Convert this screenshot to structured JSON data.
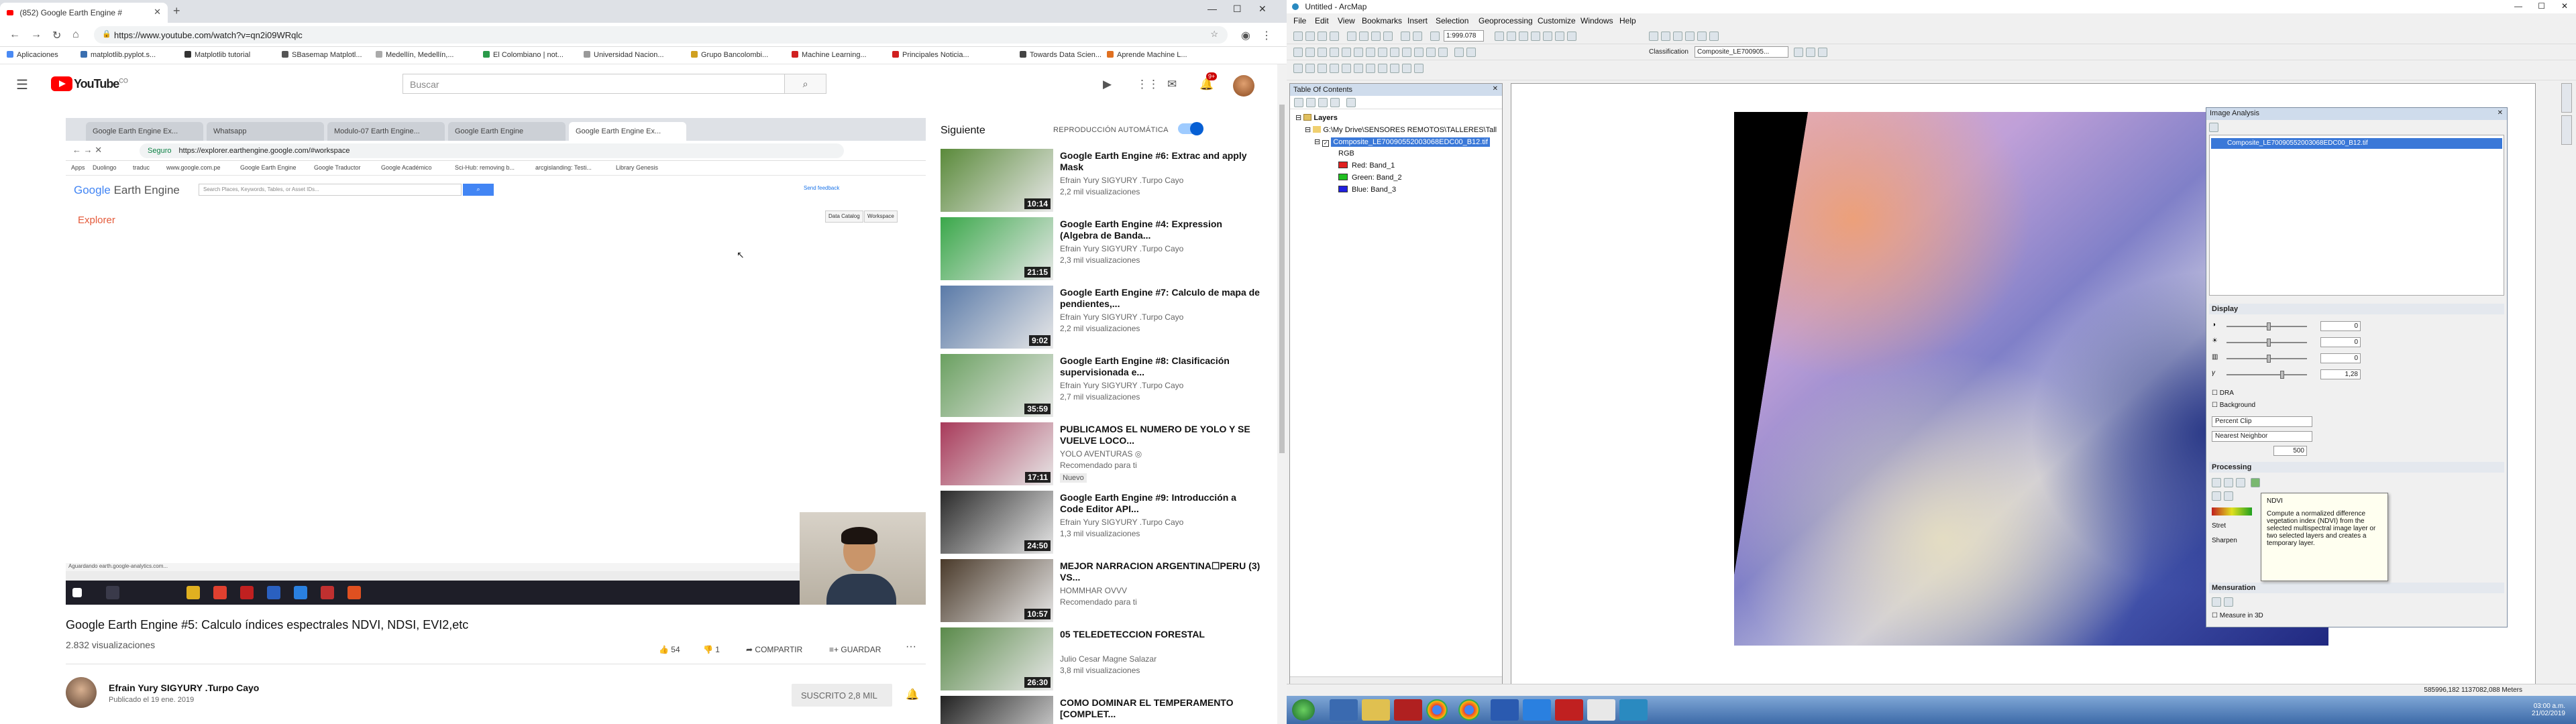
{
  "chrome": {
    "tab_title": "(852) Google Earth Engine #",
    "url": "https://www.youtube.com/watch?v=qn2i09WRqlc",
    "bookmarks": [
      "Aplicaciones",
      "matplotlib.pyplot.s...",
      "Matplotlib tutorial",
      "SBasemap Matplotl...",
      "Medellín, Medellín,...",
      "El Colombiano | not...",
      "Universidad Nacion...",
      "Grupo Bancolombi...",
      "Machine Learning...",
      "Principales Noticia...",
      "Machine Learning...",
      "Towards Data Scien...",
      "Aprende Machine L..."
    ]
  },
  "youtube": {
    "logo_text": "YouTube",
    "logo_country": "CO",
    "search_placeholder": "Buscar",
    "notification_count": "9+",
    "video": {
      "inner_tabs": [
        "Google Earth Engine Ex...",
        "Whatsapp",
        "Modulo-07 Earth Engine...",
        "Google Earth Engine",
        "Google Earth Engine Ex..."
      ],
      "inner_url": "https://explorer.earthengine.google.com/#workspace",
      "inner_secure": "Seguro",
      "inner_bookmarks": [
        "Apps",
        "Duolingo",
        "traduc",
        "www.google.com.pe",
        "Google Earth Engine",
        "Google Traductor",
        "Google Académico",
        "Sci-Hub: removing b...",
        "arcgislanding: Testi...",
        "Library Genesis"
      ],
      "gee_logo_prefix": "Google",
      "gee_logo_suffix": "Earth Engine",
      "gee_search_placeholder": "Search Places, Keywords, Tables, or Asset IDs...",
      "gee_user": "Send feedback",
      "gee_explorer": "Explorer",
      "gee_data_catalog": "Data Catalog",
      "gee_workspace": "Workspace",
      "inner_status": "Aguardando earth.google-analytics.com..."
    },
    "title": "Google Earth Engine #5: Calculo índices espectrales NDVI, NDSI, EVI2,etc",
    "views": "2.832 visualizaciones",
    "likes": "54",
    "dislikes": "1",
    "share": "COMPARTIR",
    "save": "GUARDAR",
    "channel": "Efrain Yury SIGYURY .Turpo Cayo",
    "published": "Publicado el 19 ene. 2019",
    "subscribe": "SUSCRITO  2,8 MIL",
    "next_label": "Siguiente",
    "autoplay_label": "REPRODUCCIÓN AUTOMÁTICA",
    "related": [
      {
        "title": "Google Earth Engine #6: Extrac and apply Mask",
        "channel": "Efrain Yury SIGYURY .Turpo Cayo",
        "views": "2,2 mil visualizaciones",
        "duration": "10:14",
        "color": "#5a8a3a"
      },
      {
        "title": "Google Earth Engine #4: Expression (Algebra de Banda...",
        "channel": "Efrain Yury SIGYURY .Turpo Cayo",
        "views": "2,3 mil visualizaciones",
        "duration": "21:15",
        "color": "#3aa84a"
      },
      {
        "title": "Google Earth Engine #7: Calculo de mapa de pendientes,...",
        "channel": "Efrain Yury SIGYURY .Turpo Cayo",
        "views": "2,2 mil visualizaciones",
        "duration": "9:02",
        "color": "#5a7aa8"
      },
      {
        "title": "Google Earth Engine #8: Clasificación supervisionada e...",
        "channel": "Efrain Yury SIGYURY .Turpo Cayo",
        "views": "2,7 mil visualizaciones",
        "duration": "35:59",
        "color": "#6aa060"
      },
      {
        "title": "PUBLICAMOS EL NUMERO DE YOLO Y SE VUELVE LOCO...",
        "channel": "YOLO AVENTURAS ◎",
        "views": "Recomendado para ti",
        "duration": "17:11",
        "color": "#a83a5a",
        "badge": "Nuevo"
      },
      {
        "title": "Google Earth Engine #9: Introducción a Code Editor API...",
        "channel": "Efrain Yury SIGYURY .Turpo Cayo",
        "views": "1,3 mil visualizaciones",
        "duration": "24:50",
        "color": "#2a2a2a"
      },
      {
        "title": "MEJOR NARRACION ARGENTINA☐PERU (3) VS...",
        "channel": "HOMMHAR OVVV",
        "views": "Recomendado para ti",
        "duration": "10:57",
        "color": "#4a3a2a"
      },
      {
        "title": "05 TELEDETECCION FORESTAL",
        "channel": "Julio Cesar Magne Salazar",
        "views": "3,8 mil visualizaciones",
        "duration": "26:30",
        "color": "#5a8a4a"
      },
      {
        "title": "COMO DOMINAR EL TEMPERAMENTO [COMPLET...",
        "channel": "",
        "views": "",
        "duration": "",
        "color": "#222222"
      }
    ]
  },
  "arcmap": {
    "title": "Untitled - ArcMap",
    "menus": [
      "File",
      "Edit",
      "View",
      "Bookmarks",
      "Insert",
      "Selection",
      "Geoprocessing",
      "Customize",
      "Windows",
      "Help"
    ],
    "scale": "1:999.078",
    "classification_label": "Classification",
    "classification_layer": "Composite_LE700905...",
    "toc": {
      "title": "Table Of Contents",
      "layers": "Layers",
      "folder": "G:\\My Drive\\SENSORES REMOTOS\\TALLERES\\Tall",
      "layer": "Composite_LE70090552003068EDC00_B12.tif",
      "rgb": "RGB",
      "bands": [
        {
          "label": "Red:",
          "band": "Band_1",
          "color": "#e02020"
        },
        {
          "label": "Green:",
          "band": "Band_2",
          "color": "#20c020"
        },
        {
          "label": "Blue:",
          "band": "Band_3",
          "color": "#2020e0"
        }
      ]
    },
    "image_analysis": {
      "title": "Image Analysis",
      "layer": "Composite_LE70090552003068EDC00_B12.tif",
      "display_header": "Display",
      "values": [
        "0",
        "0",
        "0",
        "1,28"
      ],
      "dra": "DRA",
      "background": "Background",
      "stretch": "Percent Clip",
      "resample": "Nearest Neighbor",
      "refresh": "500",
      "processing_header": "Processing",
      "stretch_label": "Stret",
      "sharpen_label": "Sharpen",
      "measurement_header": "Mensuration",
      "measure_label": "Measure in 3D"
    },
    "tooltip": {
      "title": "NDVI",
      "body": "Compute a normalized difference vegetation index (NDVI) from the selected multispectral image layer or two selected layers and creates a temporary layer."
    },
    "coords": "585996,182  1137082,088 Meters",
    "clock": "03:00 a.m.\n21/02/2019"
  }
}
